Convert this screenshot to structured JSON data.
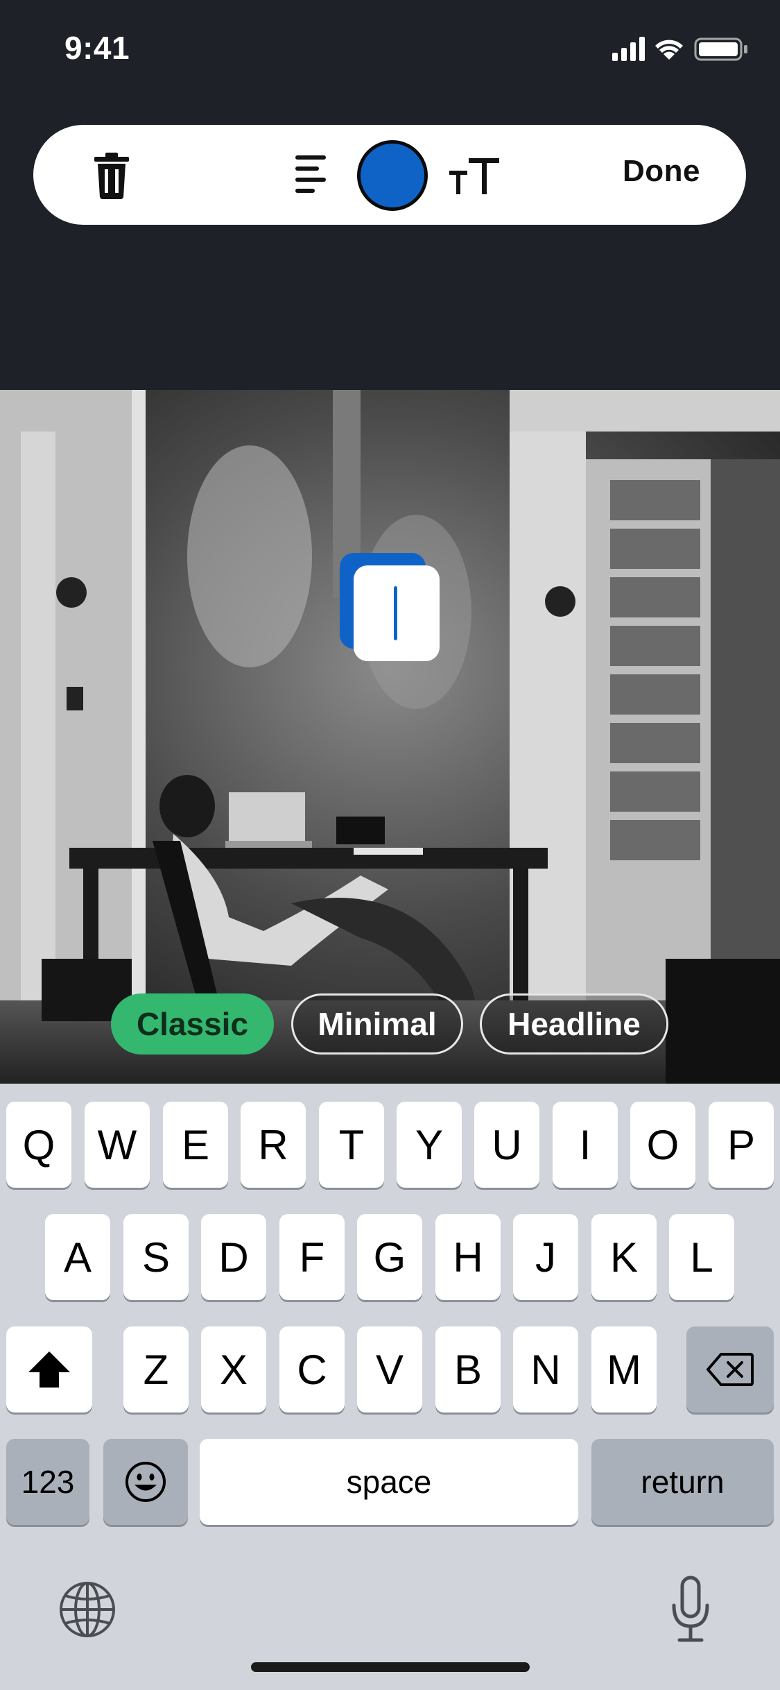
{
  "status": {
    "time": "9:41"
  },
  "toolbar": {
    "icons": [
      "trash-icon",
      "align-left-icon",
      "color-picker",
      "text-size-icon"
    ],
    "selected_color": "#0f63c7",
    "done_label": "Done"
  },
  "editor": {
    "text_value": ""
  },
  "styles": {
    "options": [
      "Classic",
      "Minimal",
      "Headline"
    ],
    "selected": "Classic",
    "selected_color": "#34b86f"
  },
  "keyboard": {
    "row1": [
      "Q",
      "W",
      "E",
      "R",
      "T",
      "Y",
      "U",
      "I",
      "O",
      "P"
    ],
    "row2": [
      "A",
      "S",
      "D",
      "F",
      "G",
      "H",
      "J",
      "K",
      "L"
    ],
    "row3": [
      "Z",
      "X",
      "C",
      "V",
      "B",
      "N",
      "M"
    ],
    "numbers_label": "123",
    "space_label": "space",
    "return_label": "return",
    "icons": [
      "shift-icon",
      "delete-icon",
      "emoji-icon",
      "globe-icon",
      "microphone-icon"
    ]
  }
}
